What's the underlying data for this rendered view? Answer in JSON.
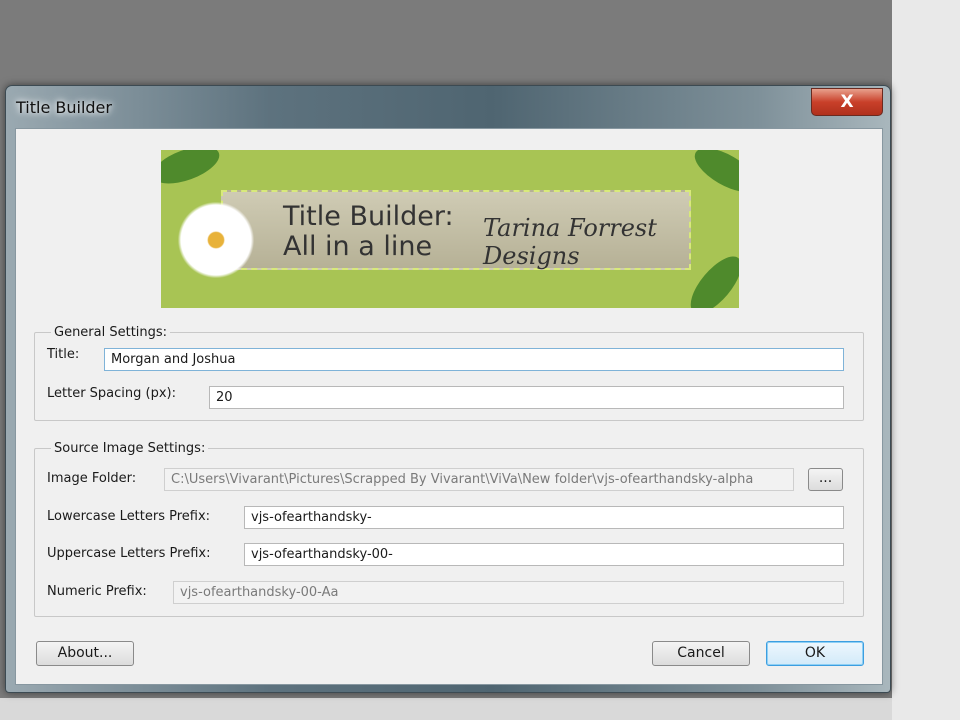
{
  "window": {
    "title": "Title Builder",
    "close_label": "X"
  },
  "banner": {
    "line1": "Title Builder:",
    "line2": "All in a line",
    "logo": "Tarina Forrest Designs"
  },
  "general": {
    "legend": "General Settings:",
    "title_label": "Title:",
    "title_value": "Morgan  and Joshua",
    "spacing_label": "Letter Spacing (px):",
    "spacing_value": "20"
  },
  "source": {
    "legend": "Source Image Settings:",
    "folder_label": "Image Folder:",
    "folder_value": "C:\\Users\\Vivarant\\Pictures\\Scrapped By Vivarant\\ViVa\\New folder\\vjs-ofearthandsky-alpha",
    "browse_label": "...",
    "lower_label": "Lowercase Letters Prefix:",
    "lower_value": "vjs-ofearthandsky-",
    "upper_label": "Uppercase Letters Prefix:",
    "upper_value": "vjs-ofearthandsky-00-",
    "numeric_label": "Numeric Prefix:",
    "numeric_value": "vjs-ofearthandsky-00-Aa"
  },
  "buttons": {
    "about": "About...",
    "cancel": "Cancel",
    "ok": "OK"
  }
}
